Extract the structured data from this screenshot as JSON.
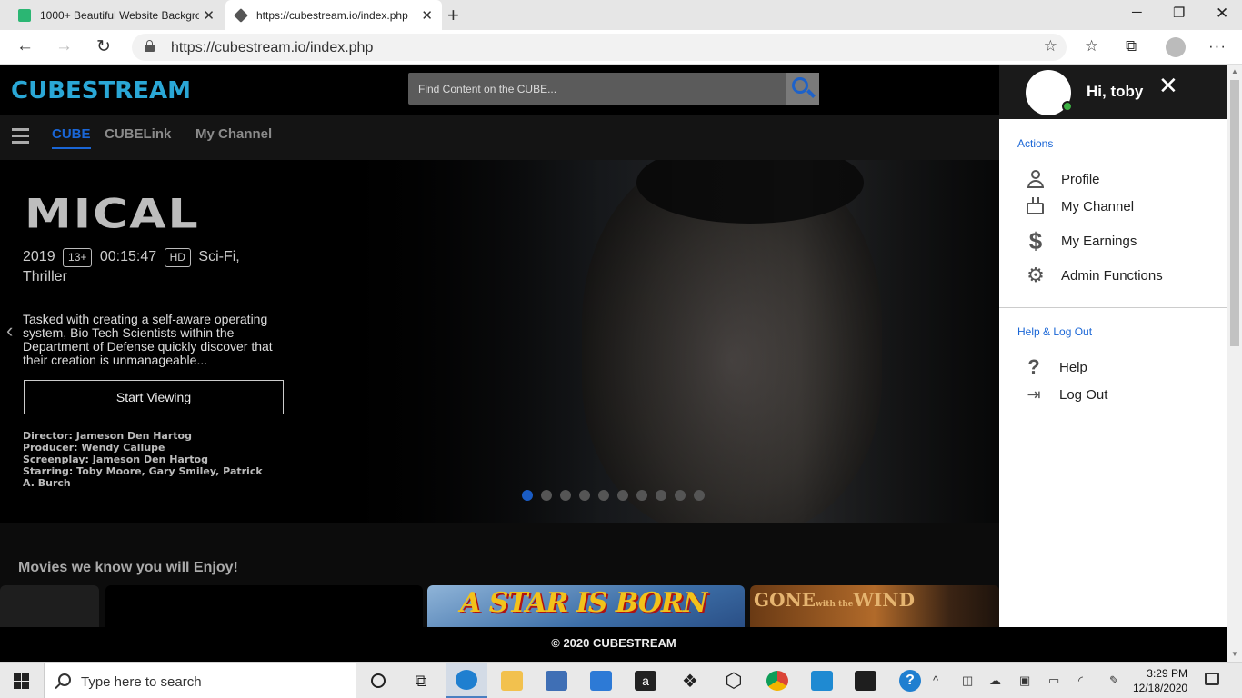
{
  "browser": {
    "tabs": [
      {
        "title": "1000+ Beautiful Website Backgro",
        "favicon_color": "#2bb673"
      },
      {
        "title": "https://cubestream.io/index.php",
        "favicon_color": "#555555"
      }
    ],
    "url": "https://cubestream.io/index.php"
  },
  "site": {
    "logo": "CUBESTREAM",
    "search": {
      "placeholder": "Find Content on the CUBE..."
    },
    "nav": [
      {
        "label": "CUBE",
        "active": true
      },
      {
        "label": "CUBELink",
        "active": false
      },
      {
        "label": "My Channel",
        "active": false
      }
    ],
    "hero": {
      "title": "MICAL",
      "year": "2019",
      "rating": "13+",
      "duration": "00:15:47",
      "quality": "HD",
      "genres": "Sci-Fi, Thriller",
      "description": "Tasked with creating a self-aware operating system, Bio Tech Scientists within the Department of Defense quickly discover that their creation is unmanageable...",
      "cta": "Start Viewing",
      "credits": {
        "director": "Director: Jameson Den Hartog",
        "producer": "Producer: Wendy Callupe",
        "screenplay": "Screenplay: Jameson Den Hartog",
        "starring": "Starring: Toby Moore, Gary Smiley, Patrick A. Burch"
      },
      "slides_total": 10,
      "slide_active": 1
    },
    "section_title": "Movies we know you will Enjoy!",
    "cards": [
      {
        "title": ""
      },
      {
        "title": ""
      },
      {
        "title": "A STAR IS BORN"
      },
      {
        "title": "GONE",
        "title_small": "with the",
        "title_end": "WIND"
      }
    ],
    "footer": "© 2020 CUBESTREAM"
  },
  "panel": {
    "greeting": "Hi, toby",
    "actions_heading": "Actions",
    "actions": [
      {
        "label": "Profile",
        "icon": "user-icon"
      },
      {
        "label": "My Channel",
        "icon": "tv-icon"
      },
      {
        "label": "My Earnings",
        "icon": "dollar-icon"
      },
      {
        "label": "Admin Functions",
        "icon": "gear-icon"
      }
    ],
    "help_heading": "Help & Log Out",
    "help_items": [
      {
        "label": "Help",
        "icon": "question-icon"
      },
      {
        "label": "Log Out",
        "icon": "logout-icon"
      }
    ]
  },
  "taskbar": {
    "search_placeholder": "Type here to search",
    "time": "3:29 PM",
    "date": "12/18/2020"
  }
}
